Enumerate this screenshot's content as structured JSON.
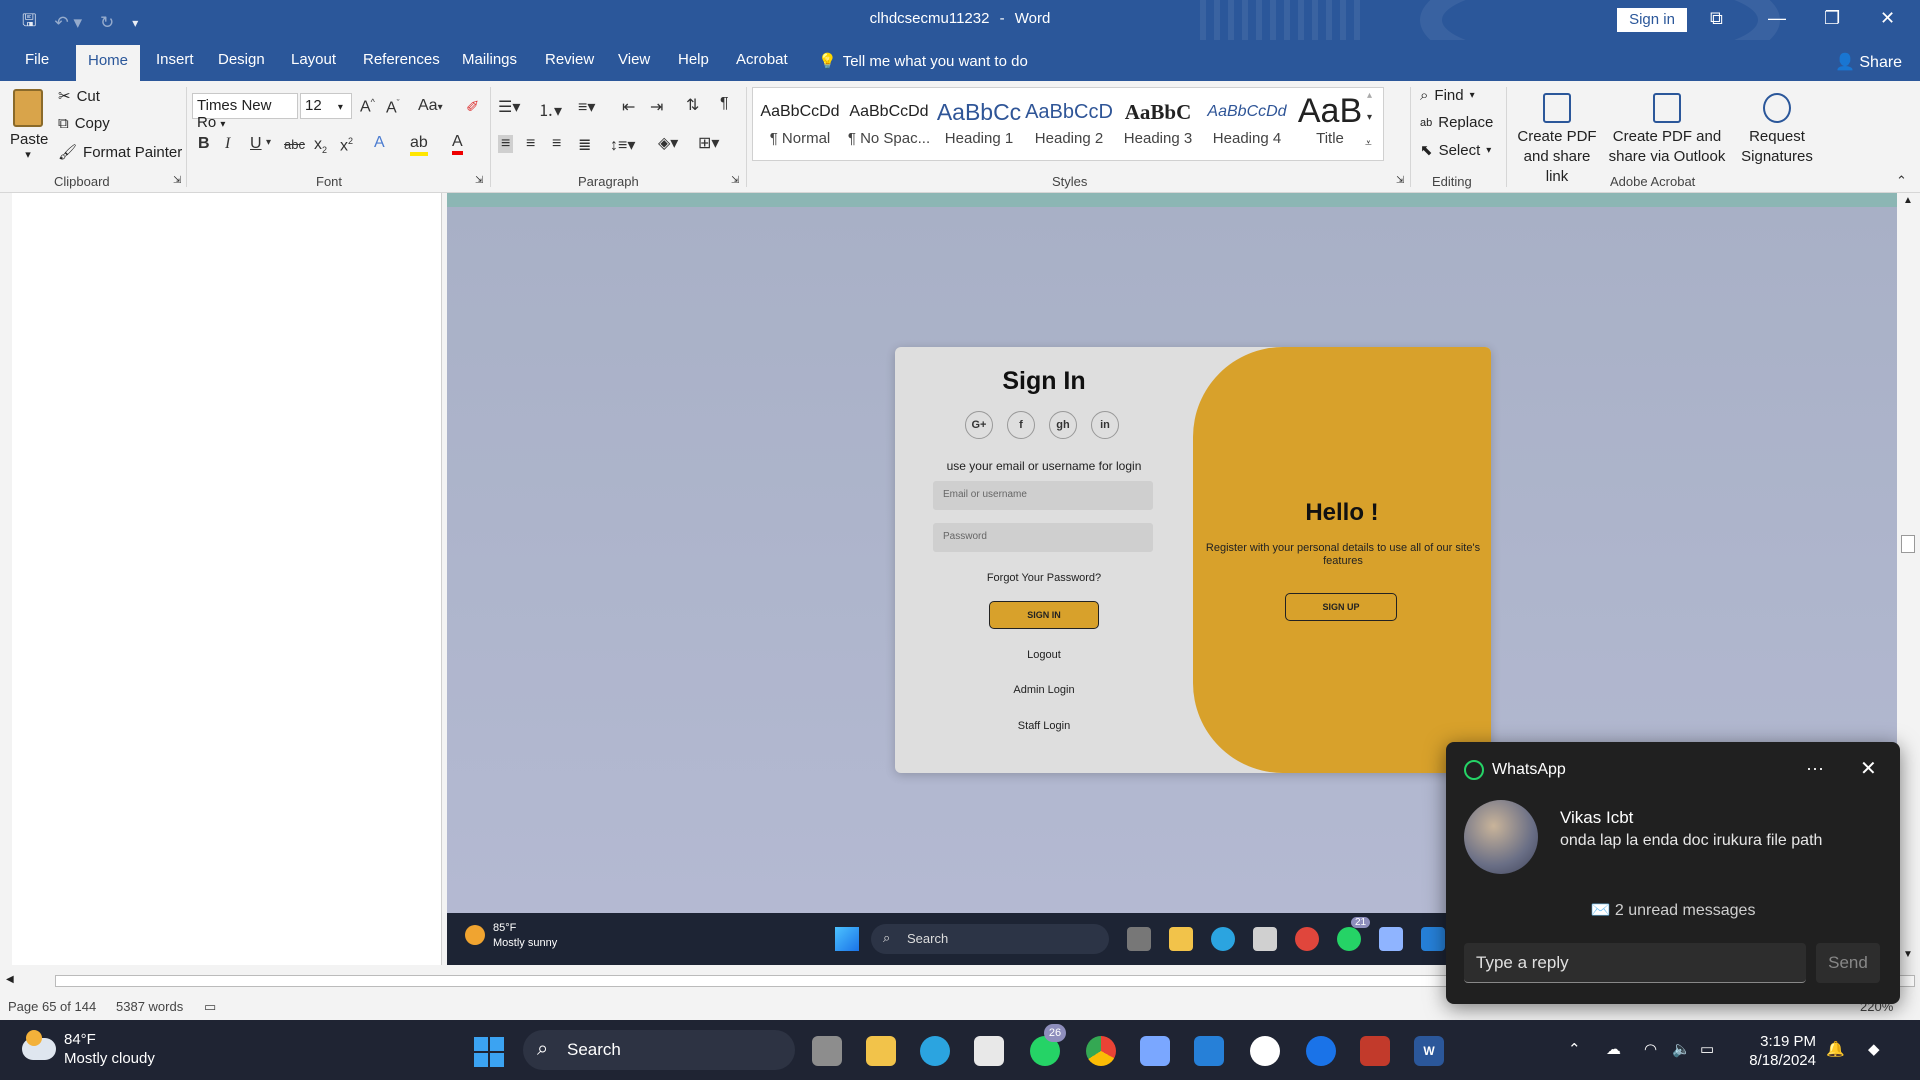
{
  "titlebar": {
    "document_title": "clhdcsecmu11232",
    "app_name": "Word",
    "separator": "-",
    "signin_label": "Sign in"
  },
  "tabs": {
    "items": [
      {
        "label": "File"
      },
      {
        "label": "Home"
      },
      {
        "label": "Insert"
      },
      {
        "label": "Design"
      },
      {
        "label": "Layout"
      },
      {
        "label": "References"
      },
      {
        "label": "Mailings"
      },
      {
        "label": "Review"
      },
      {
        "label": "View"
      },
      {
        "label": "Help"
      },
      {
        "label": "Acrobat"
      }
    ],
    "active": "Home",
    "tell_me": "Tell me what you want to do",
    "share": "Share"
  },
  "clipboard": {
    "paste": "Paste",
    "cut": "Cut",
    "copy": "Copy",
    "format_painter": "Format Painter",
    "label": "Clipboard"
  },
  "font": {
    "family": "Times New Ro",
    "size": "12",
    "label": "Font",
    "case_label": "Aa",
    "bold": "B",
    "italic": "I",
    "underline": "U",
    "strike": "abc"
  },
  "paragraph": {
    "label": "Paragraph"
  },
  "styles": {
    "label": "Styles",
    "items": [
      {
        "preview": "AaBbCcDd",
        "name": "¶ Normal"
      },
      {
        "preview": "AaBbCcDd",
        "name": "¶ No Spac..."
      },
      {
        "preview": "AaBbCc",
        "name": "Heading 1"
      },
      {
        "preview": "AaBbCcD",
        "name": "Heading 2"
      },
      {
        "preview": "AaBbC",
        "name": "Heading 3"
      },
      {
        "preview": "AaBbCcDd",
        "name": "Heading 4"
      },
      {
        "preview": "AaB",
        "name": "Title"
      }
    ]
  },
  "editing": {
    "find": "Find",
    "replace": "Replace",
    "select": "Select",
    "label": "Editing"
  },
  "acrobat": {
    "label": "Adobe Acrobat",
    "create_pdf_line1": "Create PDF",
    "create_pdf_line2": "and share link",
    "create_outlook_line1": "Create PDF and",
    "create_outlook_line2": "share via Outlook",
    "request_line1": "Request",
    "request_line2": "Signatures"
  },
  "login_card": {
    "title": "Sign In",
    "socials": [
      "G+",
      "f",
      "gh",
      "in"
    ],
    "subtitle": "use your email or username for login",
    "email_placeholder": "Email or username",
    "password_placeholder": "Password",
    "forgot": "Forgot Your Password?",
    "signin_btn": "SIGN IN",
    "logout": "Logout",
    "admin_login": "Admin Login",
    "staff_login": "Staff Login",
    "hello": "Hello !",
    "register_text": "Register with your personal details to use all of our site's features",
    "signup_btn": "SIGN UP"
  },
  "inner_taskbar": {
    "temp": "85°F",
    "weather": "Mostly sunny",
    "search": "Search",
    "badge": "21"
  },
  "statusbar": {
    "page": "Page 65 of 144",
    "words": "5387 words",
    "zoom": "220%"
  },
  "whatsapp": {
    "app": "WhatsApp",
    "sender": "Vikas Icbt",
    "message": "onda lap la enda doc irukura file path",
    "unread": "✉️ 2 unread messages",
    "reply_placeholder": "Type a reply",
    "send": "Send"
  },
  "taskbar": {
    "temp": "84°F",
    "weather": "Mostly cloudy",
    "search": "Search",
    "whatsapp_badge": "26",
    "time": "3:19 PM",
    "date": "8/18/2024"
  },
  "colors": {
    "word_blue": "#2b579a",
    "card_gold": "#d8a12b",
    "whatsapp_green": "#25d366"
  }
}
